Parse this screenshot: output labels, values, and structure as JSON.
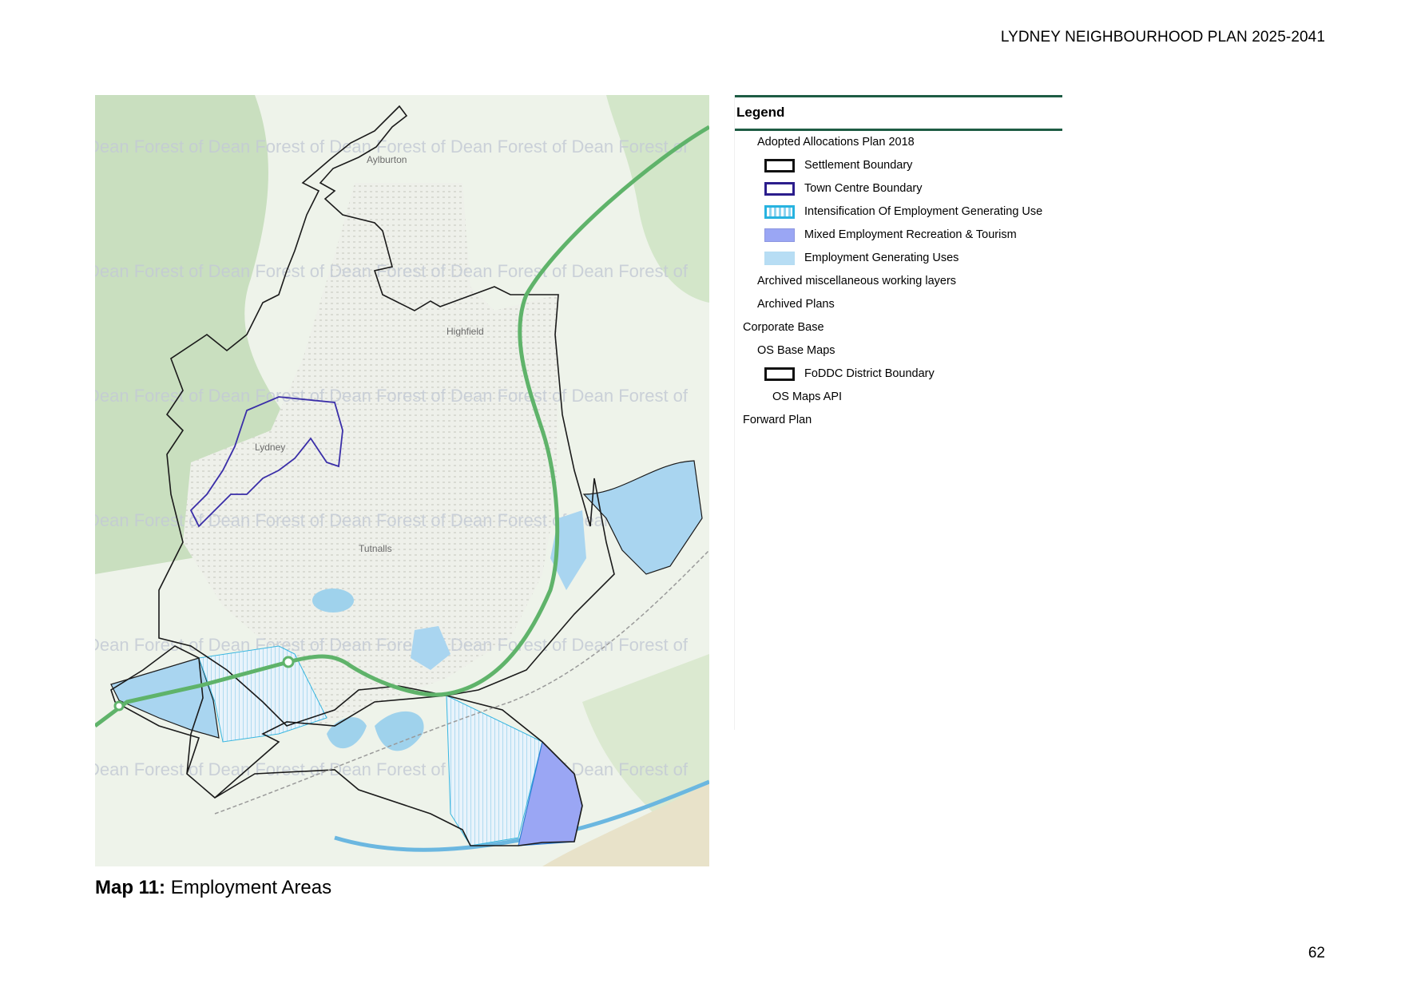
{
  "header": {
    "title": "LYDNEY NEIGHBOURHOOD PLAN 2025-2041"
  },
  "map": {
    "watermark_text": "Dean Forest of Dean Forest of Dean Forest of Dean Forest of Dean Forest of",
    "labels": {
      "lydney": "Lydney",
      "highfield": "Highfield",
      "tutnalls": "Tutnalls",
      "aylburton": "Aylburton"
    },
    "colors": {
      "settlement_boundary": "#1a1a1a",
      "town_centre_boundary": "#3a2ea8",
      "mixed_employment": "#9aa6f4",
      "employment_generating": "#a9d5f0",
      "bypass_road": "#5fb36a",
      "woodland": "#c9dfbf",
      "water": "#9fd2ec"
    }
  },
  "caption": {
    "label": "Map 11:",
    "text": "Employment Areas"
  },
  "page_number": "62",
  "legend": {
    "title": "Legend",
    "items": [
      {
        "label": "Adopted Allocations Plan 2018",
        "swatch": "none"
      },
      {
        "label": "Settlement Boundary",
        "swatch": "settlement"
      },
      {
        "label": "Town Centre Boundary",
        "swatch": "towncentre"
      },
      {
        "label": "Intensification Of Employment Generating Use",
        "swatch": "intens"
      },
      {
        "label": "Mixed Employment Recreation & Tourism",
        "swatch": "mixed"
      },
      {
        "label": "Employment Generating Uses",
        "swatch": "emp"
      },
      {
        "label": "Archived miscellaneous working layers",
        "swatch": "none"
      },
      {
        "label": "Archived Plans",
        "swatch": "none"
      },
      {
        "label": "Corporate Base",
        "swatch": "none"
      },
      {
        "label": "OS Base Maps",
        "swatch": "none"
      },
      {
        "label": "FoDDC District Boundary",
        "swatch": "district"
      },
      {
        "label": "OS Maps API",
        "swatch": "none"
      },
      {
        "label": "Forward Plan",
        "swatch": "none"
      }
    ]
  }
}
